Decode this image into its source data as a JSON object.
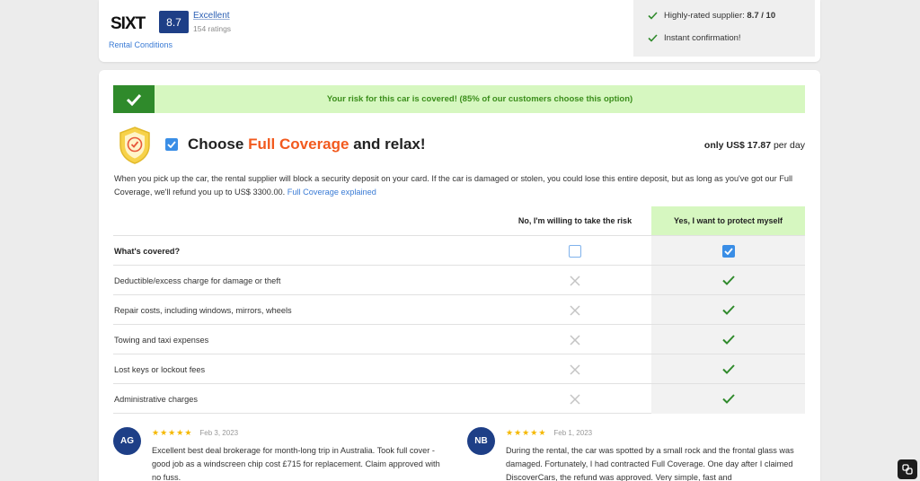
{
  "supplier": {
    "logo_text": "SIXT",
    "score": "8.7",
    "score_label": "Excellent",
    "ratings_count": "154 ratings",
    "rental_conditions_link": "Rental Conditions"
  },
  "benefits": [
    {
      "text_prefix": "Highly-rated supplier: ",
      "text_bold": "8.7 / 10"
    },
    {
      "text_prefix": "Instant confirmation!",
      "text_bold": ""
    }
  ],
  "banner": {
    "text": "Your risk for this car is covered! (85% of our customers choose this option)"
  },
  "coverage": {
    "title_prefix": "Choose ",
    "title_highlight": "Full Coverage",
    "title_suffix": " and relax!",
    "price_prefix": "only ",
    "price_amount": "US$ 17.87",
    "price_suffix": " per day",
    "description": "When you pick up the car, the rental supplier will block a security deposit on your card. If the car is damaged or stolen, you could lose this entire deposit, but as long as you've got our Full Coverage, we'll refund you up to US$ 3300.00. ",
    "explained_link": "Full Coverage explained"
  },
  "table": {
    "col_no": "No, I'm willing to take the risk",
    "col_yes": "Yes, I want to protect myself",
    "whats_covered": "What's covered?",
    "rows": [
      "Deductible/excess charge for damage or theft",
      "Repair costs, including windows, mirrors, wheels",
      "Towing and taxi expenses",
      "Lost keys or lockout fees",
      "Administrative charges"
    ]
  },
  "reviews": [
    {
      "initials": "AG",
      "stars": 5,
      "date": "Feb 3, 2023",
      "text": "Excellent best deal brokerage for month-long trip in Australia. Took full cover - good job as a windscreen chip cost £715 for replacement. Claim approved with no fuss."
    },
    {
      "initials": "NB",
      "stars": 5,
      "date": "Feb 1, 2023",
      "text": "During the rental, the car was spotted by a small rock and the frontal glass was damaged. Fortunately, I had contracted Full Coverage. One day after I claimed DiscoverCars, the refund was approved. Very simple, fast and"
    }
  ],
  "colors": {
    "brand_blue": "#1e3f87",
    "accent_orange": "#f25a1e",
    "success_green": "#2f8a2b",
    "banner_green": "#d6f7c0",
    "link_blue": "#3a7bd5"
  },
  "icons": {
    "benefit": "check-icon",
    "banner": "check-icon",
    "shield": "shield-check-icon",
    "no_cell": "cross-icon",
    "yes_cell": "check-icon",
    "star": "star-icon",
    "corner": "link-icon"
  }
}
